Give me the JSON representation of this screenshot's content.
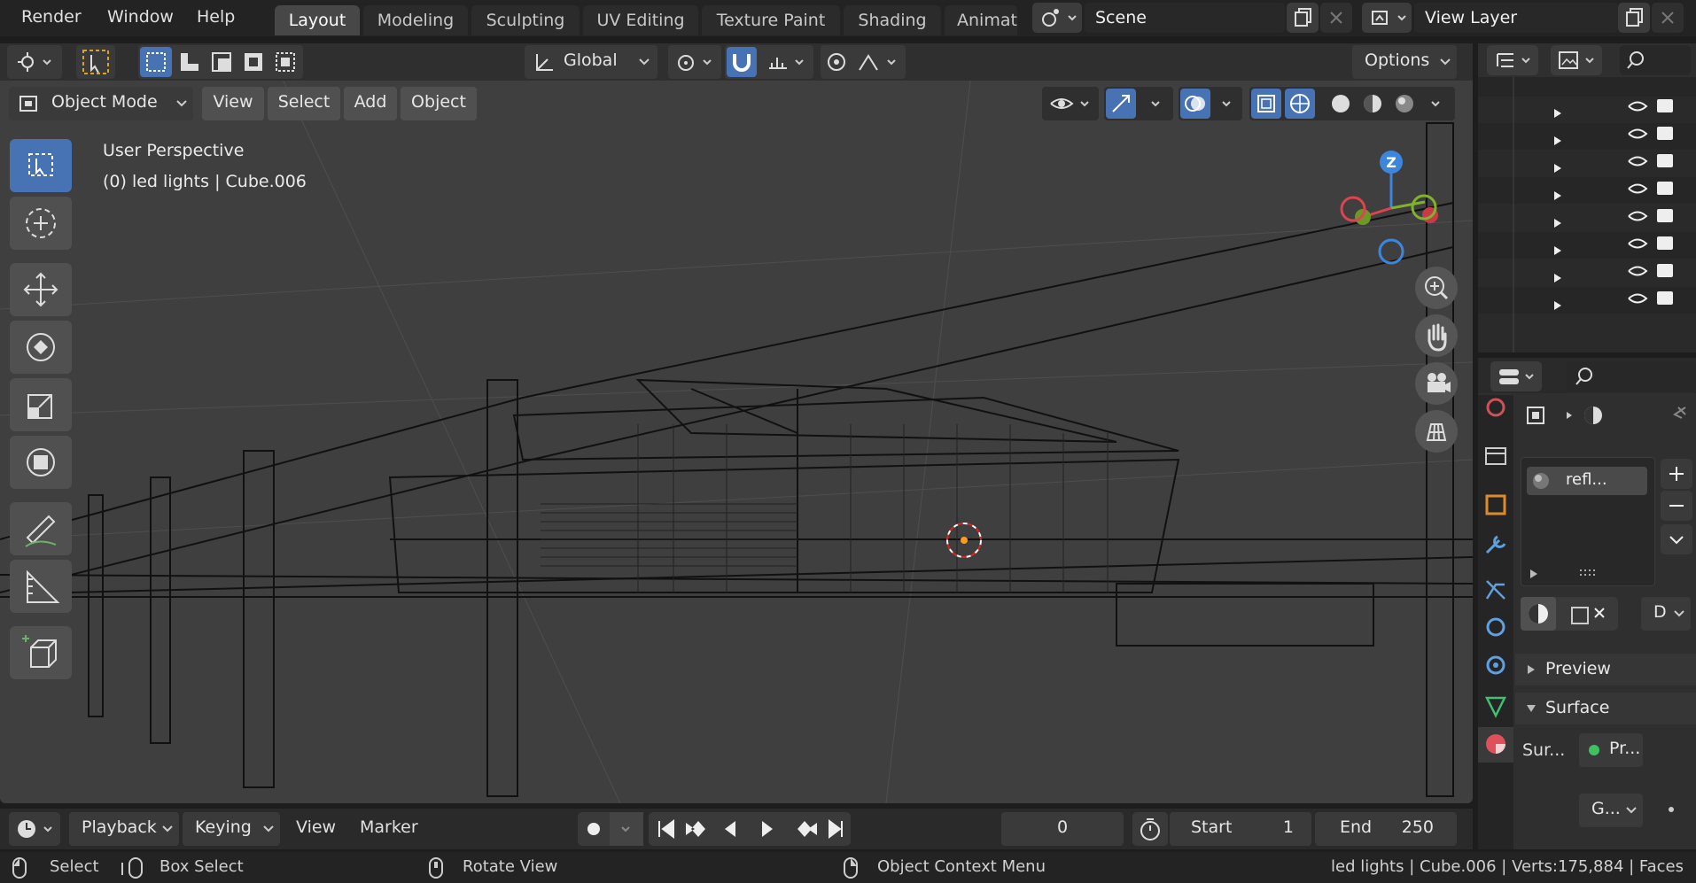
{
  "topbar": {
    "menus": [
      "Render",
      "Window",
      "Help"
    ],
    "workspaces": [
      "Layout",
      "Modeling",
      "Sculpting",
      "UV Editing",
      "Texture Paint",
      "Shading",
      "Animat"
    ],
    "active_workspace": "Layout",
    "scene": "Scene",
    "view_layer": "View Layer"
  },
  "viewport_header": {
    "transform_orientation": "Global",
    "options_label": "Options",
    "mode": "Object Mode",
    "menus": [
      "View",
      "Select",
      "Add",
      "Object"
    ]
  },
  "viewport": {
    "perspective_label": "User Perspective",
    "object_info": "(0) led lights | Cube.006",
    "gizmo_axis": "Z",
    "tools": [
      "select-box-tool-icon",
      "cursor-tool-icon",
      "move-tool-icon",
      "rotate-tool-icon",
      "scale-tool-icon",
      "transform-tool-icon",
      "annotate-tool-icon",
      "measure-tool-icon",
      "add-cube-tool-icon"
    ]
  },
  "outliner": {
    "rows": 8
  },
  "properties": {
    "material_slot": "refl...",
    "dropdown_label": "D",
    "panel_preview": "Preview",
    "panel_surface": "Surface",
    "surface_label": "Sur...",
    "surface_value": "Pr...",
    "bottom_dropdown": "G..."
  },
  "timeline": {
    "playback": "Playback",
    "keying": "Keying",
    "view": "View",
    "marker": "Marker",
    "current_frame": "0",
    "start_label": "Start",
    "start_value": "1",
    "end_label": "End",
    "end_value": "250"
  },
  "statusbar": {
    "select": "Select",
    "box_select": "Box Select",
    "rotate_view": "Rotate View",
    "context_menu": "Object Context Menu",
    "stats": "led lights | Cube.006 | Verts:175,884 | Faces"
  },
  "colors": {
    "accent_blue": "#4772b3",
    "viewport_bg": "#3f3f3f",
    "axis_x": "#e0424f",
    "axis_y": "#80b32c",
    "axis_z": "#3d86db"
  }
}
